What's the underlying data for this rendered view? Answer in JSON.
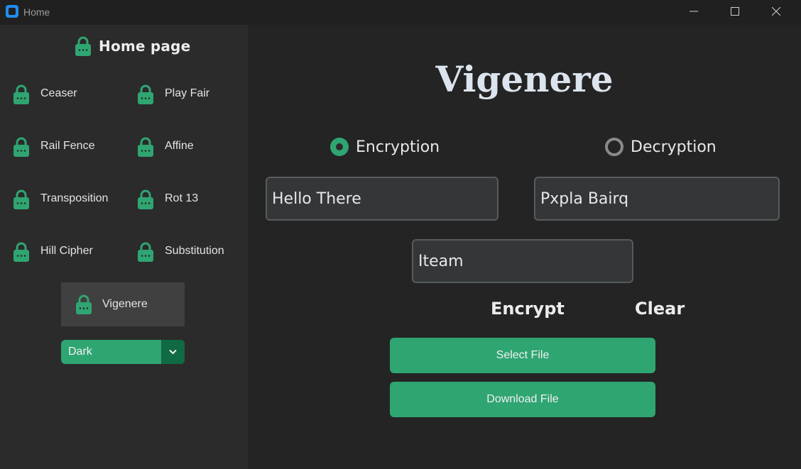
{
  "window": {
    "title": "Home"
  },
  "sidebar": {
    "title": "Home page",
    "items": [
      {
        "label": "Ceaser"
      },
      {
        "label": "Play Fair"
      },
      {
        "label": "Rail Fence"
      },
      {
        "label": "Affine"
      },
      {
        "label": "Transposition"
      },
      {
        "label": "Rot 13"
      },
      {
        "label": "Hill Cipher"
      },
      {
        "label": "Substitution"
      }
    ],
    "active_item": {
      "label": "Vigenere"
    },
    "theme": {
      "value": "Dark"
    }
  },
  "main": {
    "title": "Vigenere",
    "mode": {
      "encryption_label": "Encryption",
      "decryption_label": "Decryption",
      "selected": "Encryption"
    },
    "plaintext": {
      "value": "Hello There"
    },
    "ciphertext": {
      "value": "Pxpla Bairq"
    },
    "key": {
      "value": "Iteam"
    },
    "encrypt_label": "Encrypt",
    "clear_label": "Clear",
    "select_file_label": "Select File",
    "download_file_label": "Download File"
  },
  "icons": {
    "app": "app-logo-icon",
    "lock": "lock-icon",
    "minimize": "minimize-icon",
    "maximize": "maximize-icon",
    "close": "close-icon",
    "dropdown": "chevron-down-icon"
  },
  "colors": {
    "accent": "#2fa572",
    "accent_dark": "#106a43",
    "sidebar_bg": "#2b2b2b",
    "main_bg": "#242424",
    "active_bg": "#404040"
  }
}
